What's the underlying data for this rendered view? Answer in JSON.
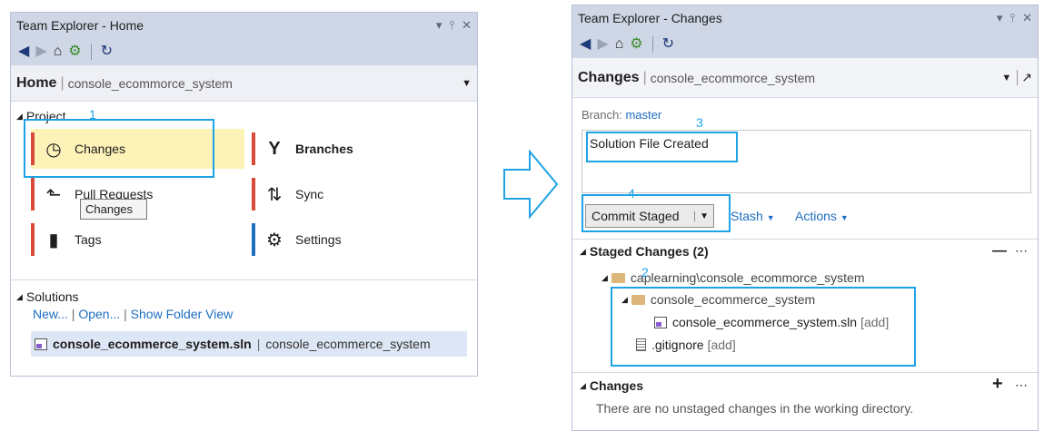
{
  "left_panel": {
    "title": "Team Explorer - Home",
    "title_controls": [
      "▾",
      "⫯",
      "✕"
    ],
    "header_title": "Home",
    "header_subtitle": "console_ecommorce_system",
    "project_label": "Project",
    "tiles": [
      {
        "label": "Changes",
        "icon": "clock-icon",
        "bar": "#d94a38"
      },
      {
        "label": "Branches",
        "icon": "branch-icon",
        "bar": "#d94a38"
      },
      {
        "label": "Pull Requests",
        "icon": "pull-request-icon",
        "bar": "#d94a38"
      },
      {
        "label": "Sync",
        "icon": "sync-icon",
        "bar": "#d94a38"
      },
      {
        "label": "Tags",
        "icon": "tag-icon",
        "bar": "#d94a38"
      },
      {
        "label": "Settings",
        "icon": "gear-icon",
        "bar": "#1e6ec1"
      }
    ],
    "tooltip": "Changes",
    "solutions_label": "Solutions",
    "solution_links": [
      "New...",
      "Open...",
      "Show Folder View"
    ],
    "solution_file": "console_ecommerce_system.sln",
    "solution_path": "console_ecommerce_system",
    "callout_number": "1"
  },
  "arrow_icon": "right-arrow-icon",
  "right_panel": {
    "title": "Team Explorer - Changes",
    "title_controls": [
      "▾",
      "⫯",
      "✕"
    ],
    "header_title": "Changes",
    "header_subtitle": "console_ecommorce_system",
    "branch_label": "Branch:",
    "branch_name": "master",
    "commit_message": "Solution File Created",
    "commit_button": "Commit Staged",
    "stash_link": "Stash",
    "actions_link": "Actions",
    "staged_header": "Staged Changes (2)",
    "staged_root": "caplearning\\console_ecommorce_system",
    "staged_folder": "console_ecommerce_system",
    "staged_sln": "console_ecommerce_system.sln",
    "staged_sln_tag": "[add]",
    "staged_gitignore": ".gitignore",
    "staged_gitignore_tag": "[add]",
    "changes_header": "Changes",
    "changes_empty": "There are no unstaged changes in the working directory.",
    "callouts": [
      "2",
      "3",
      "4"
    ]
  },
  "colors": {
    "accent": "#1ea3e6",
    "titlebar": "#cfd6e5",
    "link": "#1e6ec1",
    "tile_selected": "#fdf2b8"
  }
}
